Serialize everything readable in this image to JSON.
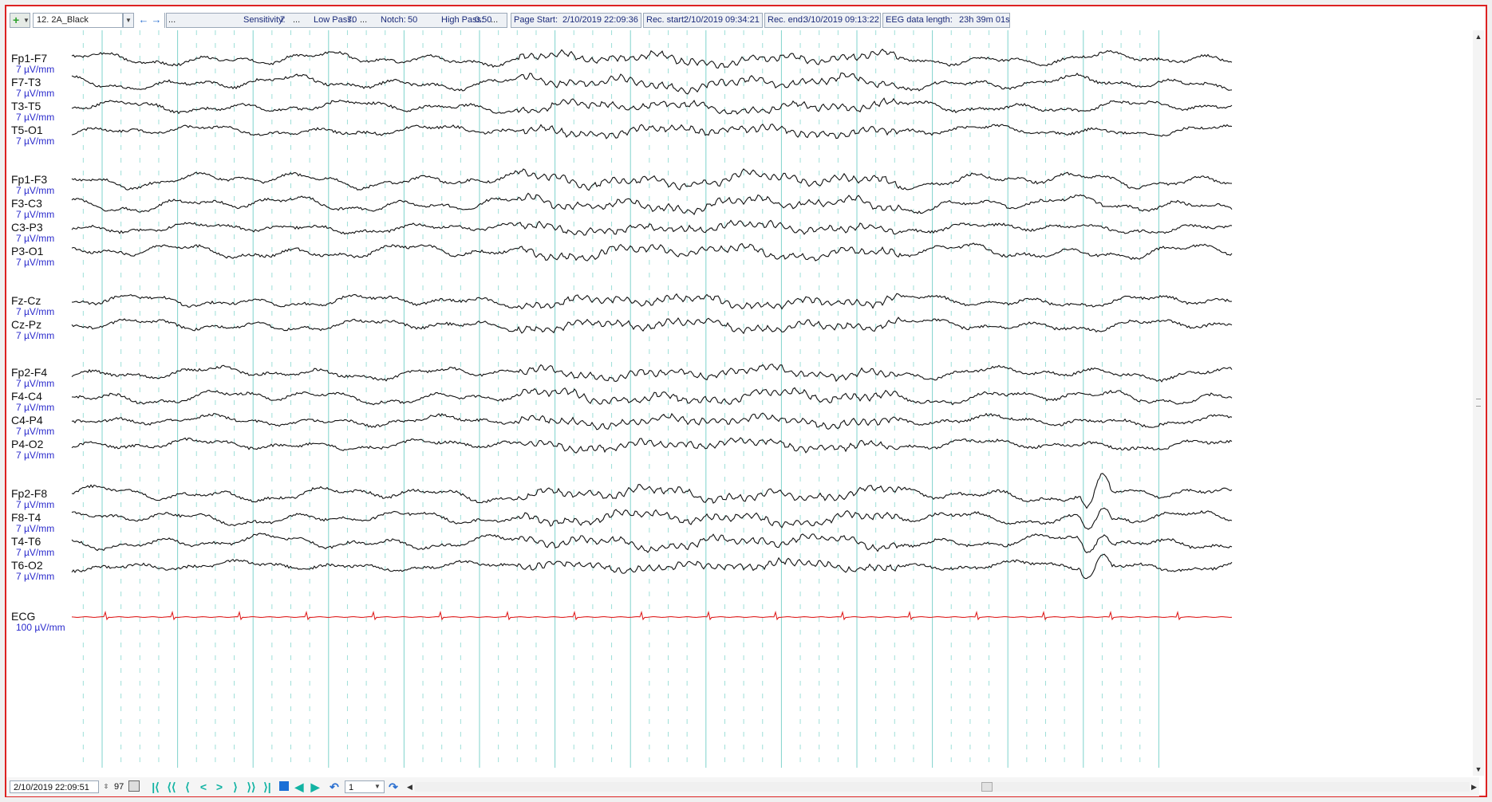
{
  "toolbar": {
    "montage": "12. 2A_Black",
    "ellipsis": "...",
    "sensitivity_label": "Sensitivity:",
    "sensitivity_value": "7",
    "low_pass_label": "Low Pass:",
    "low_pass_value": "70",
    "notch_label": "Notch:",
    "notch_value": "50",
    "high_pass_label": "High Pass:",
    "high_pass_value": "0.50",
    "page_start_label": "Page Start:",
    "page_start_value": "2/10/2019 22:09:36",
    "rec_start_label": "Rec. start:",
    "rec_start_value": "2/10/2019 09:34:21",
    "rec_end_label": "Rec. end:",
    "rec_end_value": "3/10/2019 09:13:22",
    "eeg_length_label": "EEG data length:",
    "eeg_length_value": "23h 39m 01s"
  },
  "channels": [
    {
      "name": "Fp1-F7",
      "sens": "7 µV/mm"
    },
    {
      "name": "F7-T3",
      "sens": "7 µV/mm"
    },
    {
      "name": "T3-T5",
      "sens": "7 µV/mm"
    },
    {
      "name": "T5-O1",
      "sens": "7 µV/mm"
    },
    {
      "name": "Fp1-F3",
      "sens": "7 µV/mm"
    },
    {
      "name": "F3-C3",
      "sens": "7 µV/mm"
    },
    {
      "name": "C3-P3",
      "sens": "7 µV/mm"
    },
    {
      "name": "P3-O1",
      "sens": "7 µV/mm"
    },
    {
      "name": "Fz-Cz",
      "sens": "7 µV/mm"
    },
    {
      "name": "Cz-Pz",
      "sens": "7 µV/mm"
    },
    {
      "name": "Fp2-F4",
      "sens": "7 µV/mm"
    },
    {
      "name": "F4-C4",
      "sens": "7 µV/mm"
    },
    {
      "name": "C4-P4",
      "sens": "7 µV/mm"
    },
    {
      "name": "P4-O2",
      "sens": "7 µV/mm"
    },
    {
      "name": "Fp2-F8",
      "sens": "7 µV/mm"
    },
    {
      "name": "F8-T4",
      "sens": "7 µV/mm"
    },
    {
      "name": "T4-T6",
      "sens": "7 µV/mm"
    },
    {
      "name": "T6-O2",
      "sens": "7 µV/mm"
    },
    {
      "name": "ECG",
      "sens": "100 µV/mm"
    }
  ],
  "colors": {
    "trace": "#111111",
    "ecg": "#e02020",
    "grid_major": "#7fd3cc",
    "grid_minor": "#9edfd8",
    "frame": "#dd2222",
    "label_units": "#2a2acc"
  },
  "bottom": {
    "cursor_time": "2/10/2019 22:09:51",
    "page_number": "97",
    "page_spin": "1"
  }
}
